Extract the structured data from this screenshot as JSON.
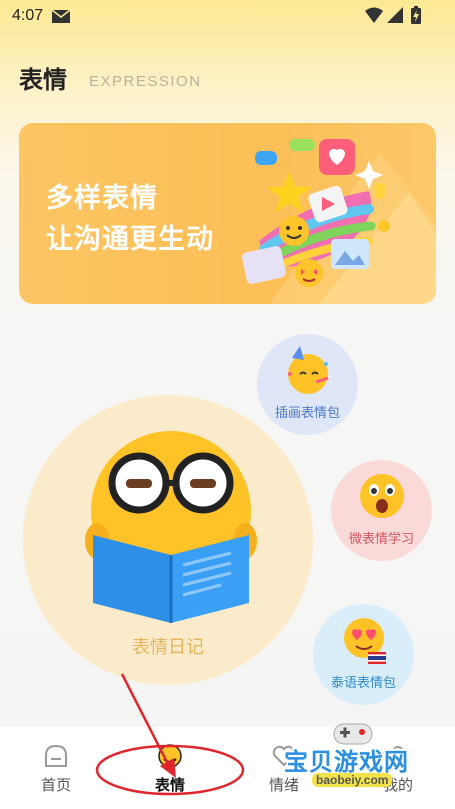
{
  "status_bar": {
    "time": "4:07"
  },
  "header": {
    "title": "表情",
    "subtitle": "EXPRESSION"
  },
  "banner": {
    "line1": "多样表情",
    "line2": "让沟通更生动"
  },
  "categories": {
    "diary": {
      "label": "表情日记"
    },
    "illustration_pack": {
      "label": "插画表情包"
    },
    "micro_expression": {
      "label": "微表情学习"
    },
    "thai_pack": {
      "label": "泰语表情包"
    }
  },
  "bottom_nav": {
    "items": [
      {
        "label": "首页",
        "active": false
      },
      {
        "label": "表情",
        "active": true
      },
      {
        "label": "情绪",
        "active": false
      },
      {
        "label": "我的",
        "active": false
      }
    ]
  },
  "watermark": {
    "title": "宝贝游戏网",
    "url": "baobeiy.com"
  },
  "colors": {
    "banner": "#fdc05a",
    "diary_bubble": "#fcebca",
    "annotation": "#e0262c"
  }
}
